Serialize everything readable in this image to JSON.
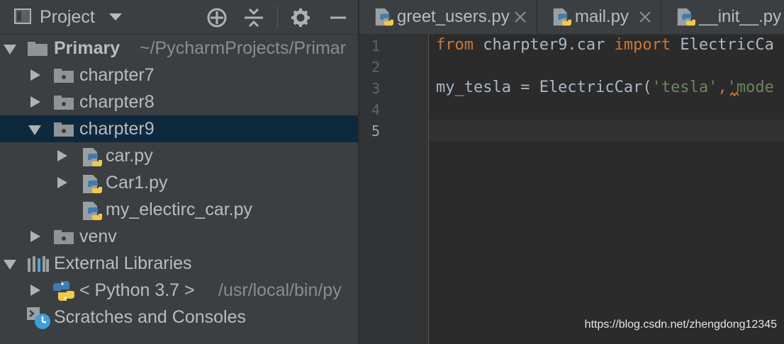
{
  "project_panel": {
    "title": "Project",
    "tree": [
      {
        "label": "Primary",
        "path": "~/PycharmProjects/Primar"
      },
      {
        "label": "charpter7"
      },
      {
        "label": "charpter8"
      },
      {
        "label": "charpter9"
      },
      {
        "label": "car.py"
      },
      {
        "label": "Car1.py"
      },
      {
        "label": "my_electirc_car.py"
      },
      {
        "label": "venv"
      },
      {
        "label": "External Libraries"
      },
      {
        "label": "< Python 3.7 >",
        "path": "/usr/local/bin/py"
      },
      {
        "label": "Scratches and Consoles"
      }
    ]
  },
  "editor": {
    "tabs": [
      {
        "label": "greet_users.py",
        "close": "×"
      },
      {
        "label": "mail.py",
        "close": "×"
      },
      {
        "label": "__init__.py"
      }
    ],
    "line_numbers": [
      "1",
      "2",
      "3",
      "4",
      "5"
    ],
    "code": {
      "line1": {
        "kw_from": "from",
        "module": " charpter9.car ",
        "kw_import": "import",
        "name": " ElectricCa"
      },
      "line3": {
        "prefix": "my_tesla = ElectricCar(",
        "arg1": "'tesla'",
        "comma": ",",
        "arg2": "'mode"
      }
    }
  },
  "watermark": "https://blog.csdn.net/zhengdong12345",
  "colors": {
    "panel_bg": "#3c3f41",
    "editor_bg": "#2b2b2b",
    "selection": "#0d293e",
    "keyword": "#cc7832",
    "string": "#6a8759",
    "text": "#a9b7c6"
  }
}
